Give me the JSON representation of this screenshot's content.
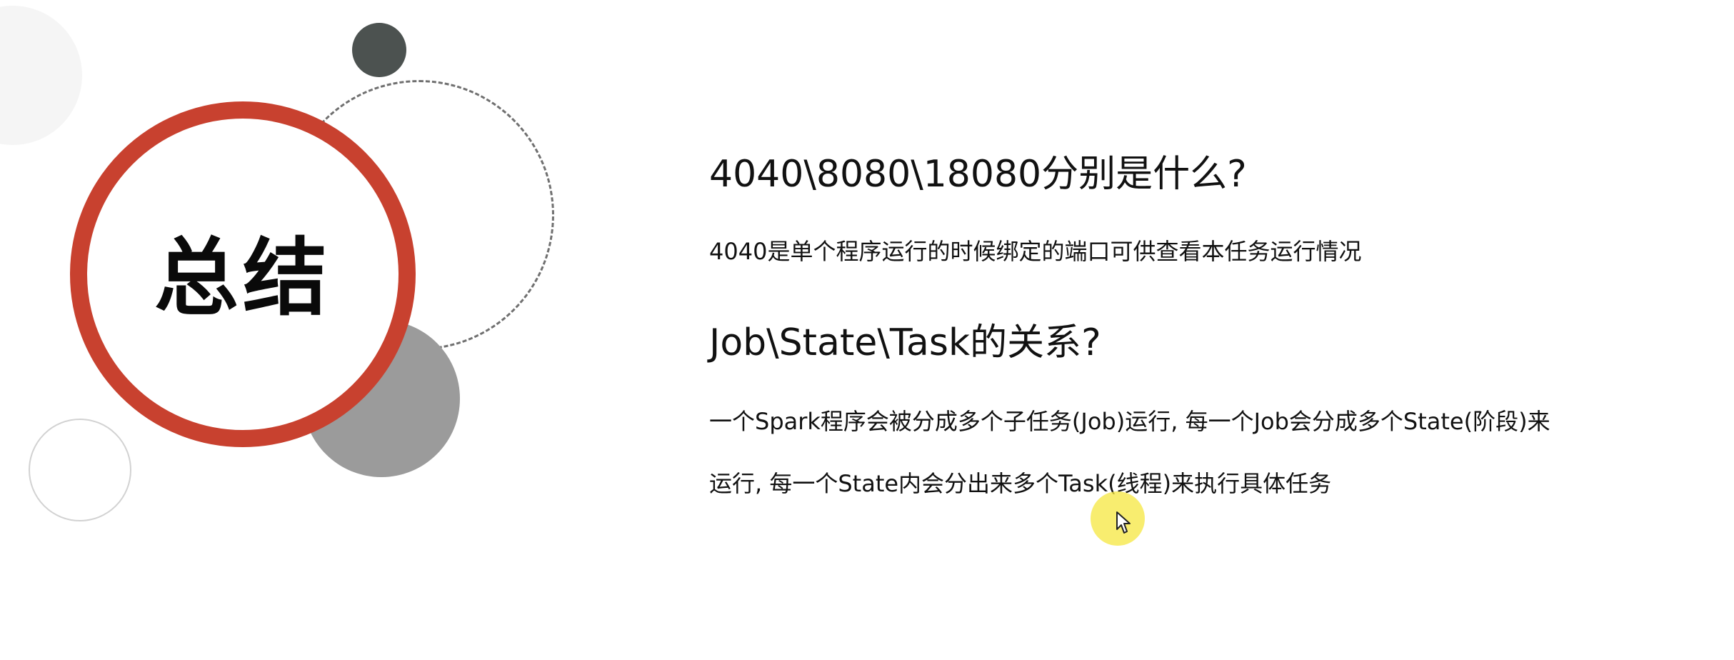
{
  "slide": {
    "title": "总结",
    "sections": [
      {
        "heading": "4040\\8080\\18080分别是什么?",
        "lines": [
          "4040是单个程序运行的时候绑定的端口可供查看本任务运行情况"
        ]
      },
      {
        "heading": "Job\\State\\Task的关系?",
        "lines": [
          "一个Spark程序会被分成多个子任务(Job)运行, 每一个Job会分成多个State(阶段)来",
          "运行, 每一个State内会分出来多个Task(线程)来执行具体任务"
        ]
      }
    ]
  },
  "colors": {
    "accent_ring": "#c8412f",
    "dark_circle": "#4c5250",
    "gray_circle": "#9b9b9b",
    "cursor_highlight": "#f6e846"
  },
  "icons": {
    "cursor": "mouse-pointer-icon"
  }
}
